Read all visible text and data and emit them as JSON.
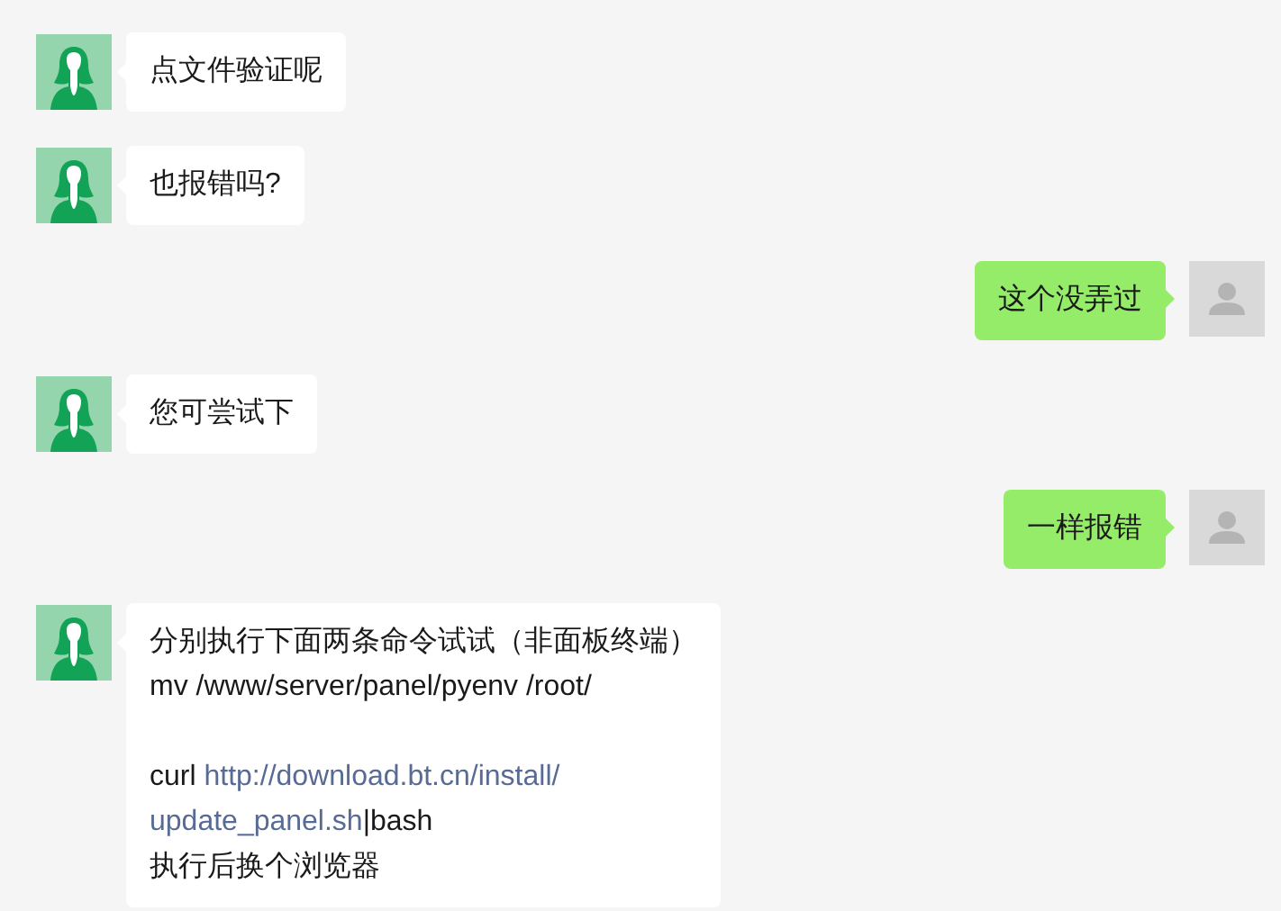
{
  "messages": [
    {
      "kind": "received",
      "paragraphs": [
        {
          "lines": [
            [
              {
                "kind": "text",
                "text": "点文件验证呢"
              }
            ]
          ]
        }
      ]
    },
    {
      "kind": "received",
      "paragraphs": [
        {
          "lines": [
            [
              {
                "kind": "text",
                "text": "也报错吗?"
              }
            ]
          ]
        }
      ]
    },
    {
      "kind": "sent",
      "paragraphs": [
        {
          "lines": [
            [
              {
                "kind": "text",
                "text": "这个没弄过"
              }
            ]
          ]
        }
      ]
    },
    {
      "kind": "received",
      "paragraphs": [
        {
          "lines": [
            [
              {
                "kind": "text",
                "text": "您可尝试下"
              }
            ]
          ]
        }
      ]
    },
    {
      "kind": "sent",
      "paragraphs": [
        {
          "lines": [
            [
              {
                "kind": "text",
                "text": "一样报错"
              }
            ]
          ]
        }
      ]
    },
    {
      "kind": "received",
      "paragraphs": [
        {
          "lines": [
            [
              {
                "kind": "text",
                "text": "分别执行下面两条命令试试（非面板终端）"
              }
            ],
            [
              {
                "kind": "text",
                "text": "mv /www/server/panel/pyenv /root/"
              }
            ]
          ]
        },
        {
          "lines": [
            [
              {
                "kind": "text",
                "text": "curl "
              },
              {
                "kind": "link",
                "text": "http://download.bt.cn/install/"
              }
            ],
            [
              {
                "kind": "link",
                "text": "update_panel.sh"
              },
              {
                "kind": "text",
                "text": "|bash"
              }
            ],
            [
              {
                "kind": "text",
                "text": "执行后换个浏览器"
              }
            ]
          ]
        }
      ]
    }
  ]
}
